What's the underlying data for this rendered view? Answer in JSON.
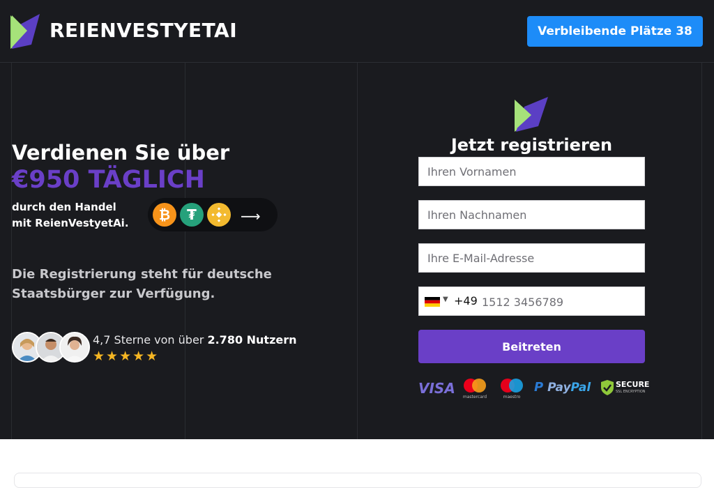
{
  "header": {
    "brand": "REIENVESTYETAI",
    "cta_label": "Verbleibende Plätze 38"
  },
  "hero": {
    "line1": "Verdienen Sie über",
    "line2": "€950 TÄGLICH",
    "sub_line1": "durch den Handel",
    "sub_line2": "mit ReienVestyetAi.",
    "coins": [
      "bitcoin-icon",
      "tether-icon",
      "binance-icon"
    ],
    "registration_note": "Die Registrierung steht für deutsche Staatsbürger zur Verfügung.",
    "rating_prefix": "4,7 Sterne von über ",
    "rating_bold": "2.780 Nutzern",
    "stars": "★★★★★"
  },
  "form": {
    "title": "Jetzt registrieren",
    "first_name_placeholder": "Ihren Vornamen",
    "last_name_placeholder": "Ihren Nachnamen",
    "email_placeholder": "Ihre E-Mail-Adresse",
    "dial_code": "+49",
    "phone_placeholder": "1512 3456789",
    "submit_label": "Beitreten"
  },
  "payments": {
    "visa": "VISA",
    "mastercard": "mastercard",
    "maestro": "maestro",
    "paypal_1": "Pay",
    "paypal_2": "Pal",
    "secure": "SECURE",
    "secure_sub": "SSL ENCRYPTION"
  },
  "colors": {
    "accent_purple": "#6a3fc7",
    "cta_blue": "#1d8cf8",
    "bg_dark": "#1a1b1f",
    "star": "#f5b623"
  }
}
